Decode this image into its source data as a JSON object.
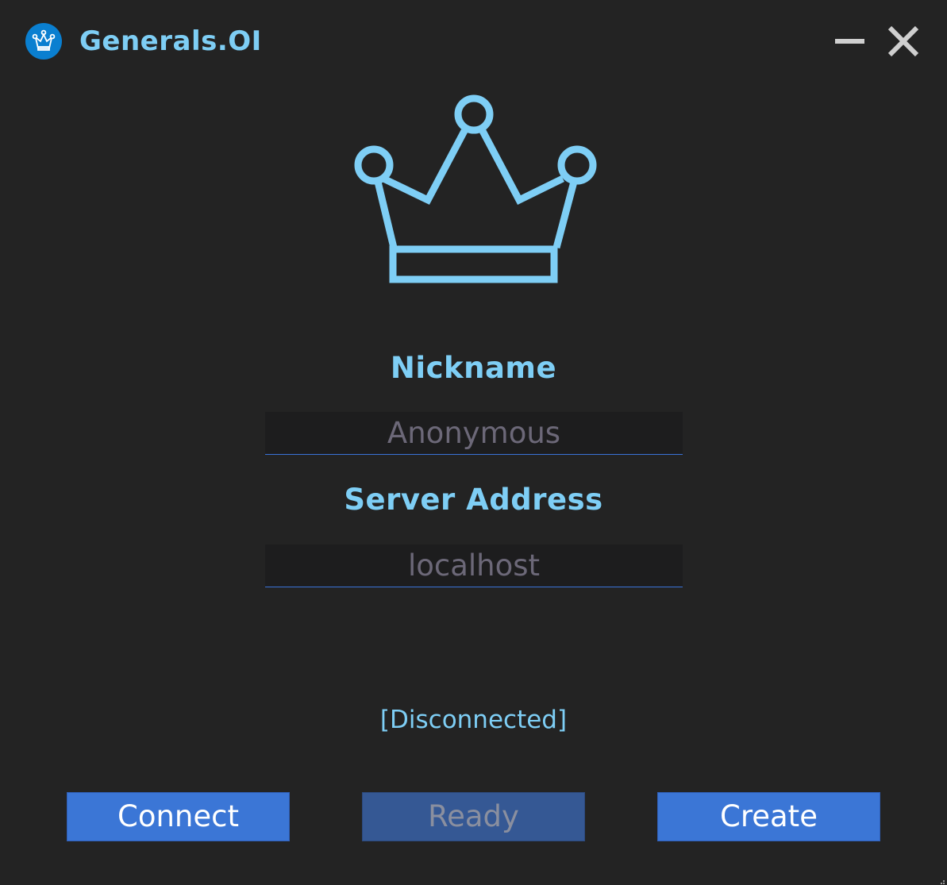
{
  "window": {
    "title": "Generals.OI",
    "accent_color": "#7ecef5",
    "logo_icon": "crown-icon"
  },
  "controls": {
    "minimize_icon": "minimize-icon",
    "close_icon": "close-icon"
  },
  "hero": {
    "icon": "crown-icon"
  },
  "form": {
    "nickname_label": "Nickname",
    "nickname_placeholder": "Anonymous",
    "nickname_value": "",
    "server_label": "Server Address",
    "server_placeholder": "localhost",
    "server_value": ""
  },
  "status": {
    "text": "[Disconnected]"
  },
  "buttons": {
    "connect_label": "Connect",
    "ready_label": "Ready",
    "ready_enabled": false,
    "create_label": "Create",
    "button_color": "#3b76d6"
  }
}
